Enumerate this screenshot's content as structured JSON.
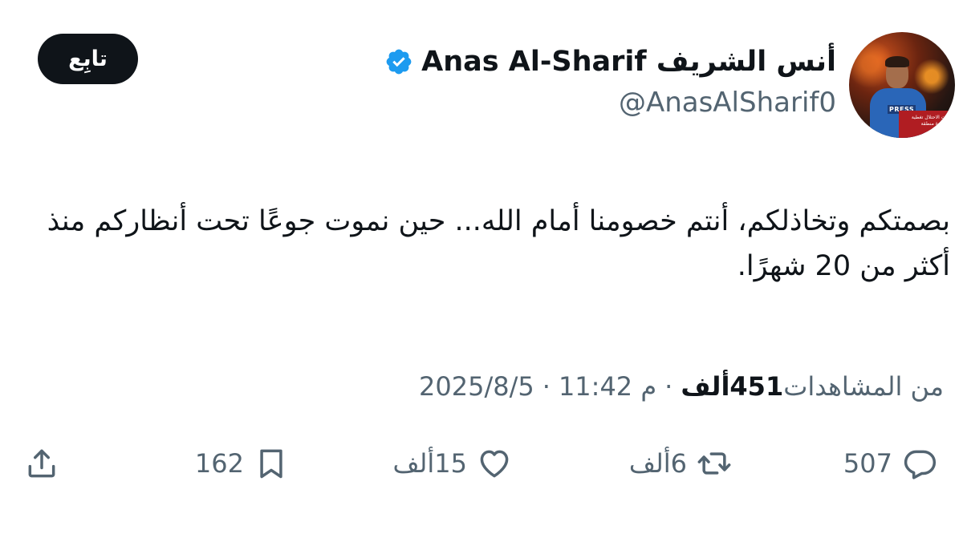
{
  "author": {
    "display_name": "أنس الشريف Anas Al-Sharif",
    "handle": "@AnasAlSharif0",
    "avatar_overlay": {
      "press_label": "PRESS",
      "banner_text": "قوات الاحتلال تغطية مستمرة منطقة"
    }
  },
  "follow_button": {
    "label": "تابِع"
  },
  "tweet": {
    "text": "بصمتكم وتخاذلكم، أنتم خصومنا أمام الله... حين نموت جوعًا تحت أنظاركم منذ أكثر من 20 شهرًا."
  },
  "meta": {
    "date": "2025/8/5",
    "time": "11:42 م",
    "separator": "·",
    "views_count": "451ألف",
    "views_label": "من المشاهدات"
  },
  "actions": {
    "replies": "507",
    "retweets": "6ألف",
    "likes": "15ألف",
    "bookmarks": "162"
  },
  "colors": {
    "text_primary": "#0f1419",
    "text_secondary": "#536471",
    "verified": "#1d9bf0",
    "button_bg": "#0f1419"
  },
  "icons": {
    "verified": "verified-badge-icon",
    "reply": "reply-bubble-icon",
    "retweet": "retweet-arrows-icon",
    "like": "heart-icon",
    "bookmark": "bookmark-icon",
    "share": "share-upload-icon"
  }
}
